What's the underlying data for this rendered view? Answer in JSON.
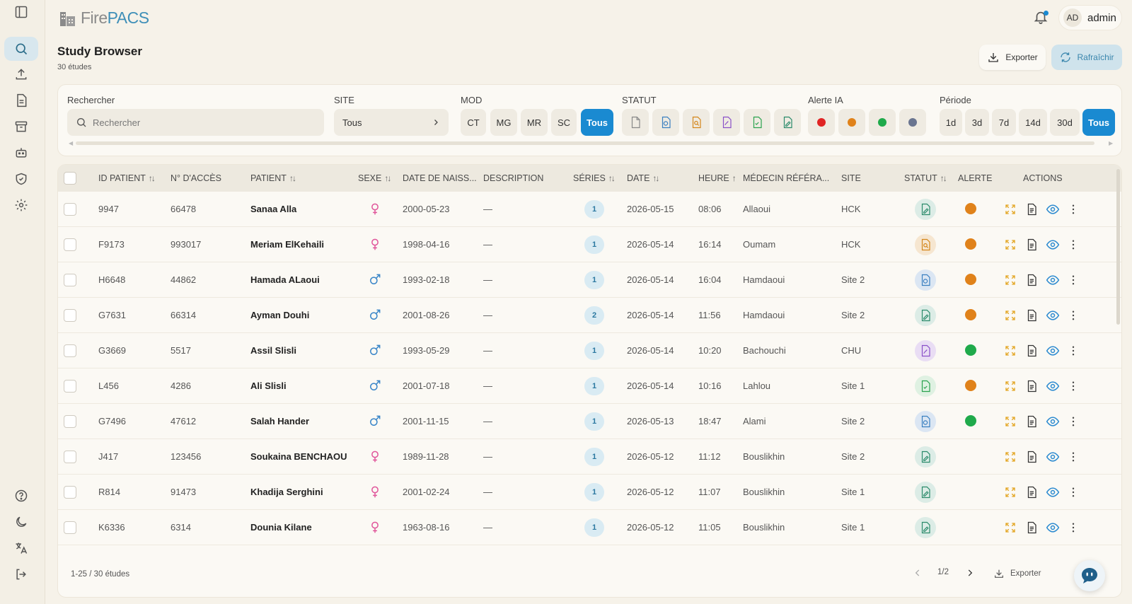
{
  "app": {
    "logo_part1": "Fire",
    "logo_part2": "PACS",
    "user_initials": "AD",
    "username": "admin"
  },
  "page": {
    "title": "Study Browser",
    "subtitle": "30 études",
    "export_label": "Exporter",
    "refresh_label": "Rafraîchir"
  },
  "filters": {
    "search_label": "Rechercher",
    "search_placeholder": "Rechercher",
    "site_label": "SITE",
    "site_value": "Tous",
    "mod_label": "MOD",
    "mod_options": [
      "CT",
      "MG",
      "MR",
      "SC",
      "Tous"
    ],
    "mod_selected": "Tous",
    "statut_label": "STATUT",
    "ai_label": "Alerte IA",
    "ai_colors": [
      "#e02424",
      "#e0821a",
      "#1faa4b",
      "#6a7590"
    ],
    "period_label": "Période",
    "period_options": [
      "1d",
      "3d",
      "7d",
      "14d",
      "30d",
      "Tous"
    ],
    "period_selected": "Tous"
  },
  "table": {
    "columns": [
      "ID PATIENT",
      "N° D'ACCÈS",
      "PATIENT",
      "SEXE",
      "DATE DE NAISS...",
      "DESCRIPTION",
      "SÉRIES",
      "DATE",
      "HEURE",
      "MÉDECIN RÉFÉRA...",
      "SITE",
      "STATUT",
      "ALERTE",
      "ACTIONS"
    ],
    "rows": [
      {
        "id": "9947",
        "access": "66478",
        "patient": "Sanaa Alla",
        "sex": "F",
        "dob": "2000-05-23",
        "desc": "—",
        "series": "1",
        "date": "2026-05-15",
        "time": "08:06",
        "doctor": "Allaoui",
        "site": "HCK",
        "status": "validated",
        "alert": "#e0821a"
      },
      {
        "id": "F9173",
        "access": "993017",
        "patient": "Meriam ElKehaili",
        "sex": "F",
        "dob": "1998-04-16",
        "desc": "—",
        "series": "1",
        "date": "2026-05-14",
        "time": "16:14",
        "doctor": "Oumam",
        "site": "HCK",
        "status": "review",
        "alert": "#e0821a"
      },
      {
        "id": "H6648",
        "access": "44862",
        "patient": "Hamada ALaoui",
        "sex": "M",
        "dob": "1993-02-18",
        "desc": "—",
        "series": "1",
        "date": "2026-05-14",
        "time": "16:04",
        "doctor": "Hamdaoui",
        "site": "Site 2",
        "status": "processing",
        "alert": "#e0821a"
      },
      {
        "id": "G7631",
        "access": "66314",
        "patient": "Ayman Douhi",
        "sex": "M",
        "dob": "2001-08-26",
        "desc": "—",
        "series": "2",
        "date": "2026-05-14",
        "time": "11:56",
        "doctor": "Hamdaoui",
        "site": "Site 2",
        "status": "validated",
        "alert": "#e0821a"
      },
      {
        "id": "G3669",
        "access": "5517",
        "patient": "Assil Slisli",
        "sex": "M",
        "dob": "1993-05-29",
        "desc": "—",
        "series": "1",
        "date": "2026-05-14",
        "time": "10:20",
        "doctor": "Bachouchi",
        "site": "CHU",
        "status": "signed",
        "alert": "#1faa4b"
      },
      {
        "id": "L456",
        "access": "4286",
        "patient": "Ali Slisli",
        "sex": "M",
        "dob": "2001-07-18",
        "desc": "—",
        "series": "1",
        "date": "2026-05-14",
        "time": "10:16",
        "doctor": "Lahlou",
        "site": "Site 1",
        "status": "done",
        "alert": "#e0821a"
      },
      {
        "id": "G7496",
        "access": "47612",
        "patient": "Salah Hander",
        "sex": "M",
        "dob": "2001-11-15",
        "desc": "—",
        "series": "1",
        "date": "2026-05-13",
        "time": "18:47",
        "doctor": "Alami",
        "site": "Site 2",
        "status": "processing",
        "alert": "#1faa4b"
      },
      {
        "id": "J417",
        "access": "123456",
        "patient": "Soukaina BENCHAOU",
        "sex": "F",
        "dob": "1989-11-28",
        "desc": "—",
        "series": "1",
        "date": "2026-05-12",
        "time": "11:12",
        "doctor": "Bouslikhin",
        "site": "Site 2",
        "status": "validated",
        "alert": ""
      },
      {
        "id": "R814",
        "access": "91473",
        "patient": "Khadija Serghini",
        "sex": "F",
        "dob": "2001-02-24",
        "desc": "—",
        "series": "1",
        "date": "2026-05-12",
        "time": "11:07",
        "doctor": "Bouslikhin",
        "site": "Site 1",
        "status": "validated",
        "alert": ""
      },
      {
        "id": "K6336",
        "access": "6314",
        "patient": "Dounia Kilane",
        "sex": "F",
        "dob": "1963-08-16",
        "desc": "—",
        "series": "1",
        "date": "2026-05-12",
        "time": "11:05",
        "doctor": "Bouslikhin",
        "site": "Site 1",
        "status": "validated",
        "alert": ""
      }
    ]
  },
  "footer": {
    "range": "1-25 / 30 études",
    "page": "1/2",
    "export_label": "Exporter"
  }
}
